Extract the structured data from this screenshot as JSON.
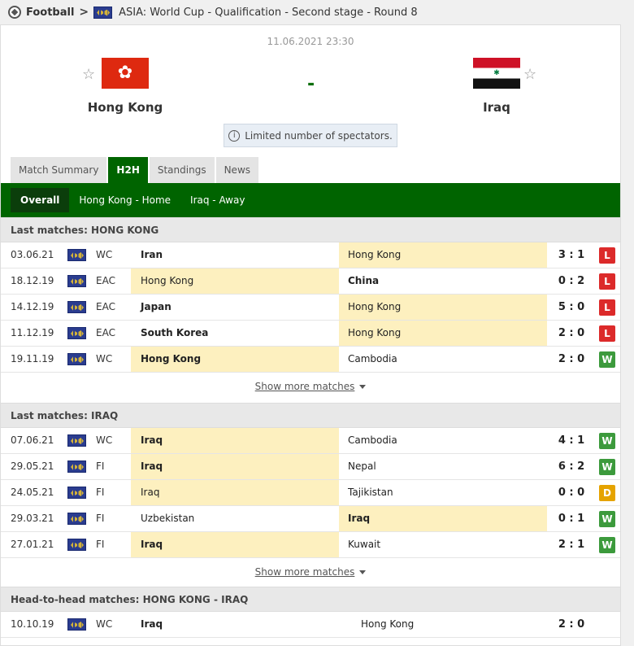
{
  "breadcrumb": {
    "sport": "Football",
    "competition": "ASIA: World Cup - Qualification - Second stage - Round 8"
  },
  "match": {
    "datetime": "11.06.2021 23:30",
    "home": "Hong Kong",
    "away": "Iraq",
    "score": "-",
    "info": "Limited number of spectators."
  },
  "tabs": [
    "Match Summary",
    "H2H",
    "Standings",
    "News"
  ],
  "subtabs": [
    "Overall",
    "Hong Kong - Home",
    "Iraq - Away"
  ],
  "sections": [
    {
      "title": "Last matches: HONG KONG",
      "show_more": "Show more matches",
      "rows": [
        {
          "date": "03.06.21",
          "comp": "WC",
          "home": "Iran",
          "away": "Hong Kong",
          "score": "3 : 1",
          "result": "L",
          "hl": "away",
          "bold": "home"
        },
        {
          "date": "18.12.19",
          "comp": "EAC",
          "home": "Hong Kong",
          "away": "China",
          "score": "0 : 2",
          "result": "L",
          "hl": "home",
          "bold": "away"
        },
        {
          "date": "14.12.19",
          "comp": "EAC",
          "home": "Japan",
          "away": "Hong Kong",
          "score": "5 : 0",
          "result": "L",
          "hl": "away",
          "bold": "home"
        },
        {
          "date": "11.12.19",
          "comp": "EAC",
          "home": "South Korea",
          "away": "Hong Kong",
          "score": "2 : 0",
          "result": "L",
          "hl": "away",
          "bold": "home"
        },
        {
          "date": "19.11.19",
          "comp": "WC",
          "home": "Hong Kong",
          "away": "Cambodia",
          "score": "2 : 0",
          "result": "W",
          "hl": "home",
          "bold": "home"
        }
      ]
    },
    {
      "title": "Last matches: IRAQ",
      "show_more": "Show more matches",
      "rows": [
        {
          "date": "07.06.21",
          "comp": "WC",
          "home": "Iraq",
          "away": "Cambodia",
          "score": "4 : 1",
          "result": "W",
          "hl": "home",
          "bold": "home"
        },
        {
          "date": "29.05.21",
          "comp": "FI",
          "home": "Iraq",
          "away": "Nepal",
          "score": "6 : 2",
          "result": "W",
          "hl": "home",
          "bold": "home"
        },
        {
          "date": "24.05.21",
          "comp": "FI",
          "home": "Iraq",
          "away": "Tajikistan",
          "score": "0 : 0",
          "result": "D",
          "hl": "home",
          "bold": ""
        },
        {
          "date": "29.03.21",
          "comp": "FI",
          "home": "Uzbekistan",
          "away": "Iraq",
          "score": "0 : 1",
          "result": "W",
          "hl": "away",
          "bold": "away"
        },
        {
          "date": "27.01.21",
          "comp": "FI",
          "home": "Iraq",
          "away": "Kuwait",
          "score": "2 : 1",
          "result": "W",
          "hl": "home",
          "bold": "home"
        }
      ]
    },
    {
      "title": "Head-to-head matches: HONG KONG - IRAQ",
      "rows": [
        {
          "date": "10.10.19",
          "comp": "WC",
          "home": "Iraq",
          "away": "Hong Kong",
          "score": "2 : 0",
          "result": "",
          "hl": "",
          "bold": "home"
        }
      ]
    }
  ]
}
